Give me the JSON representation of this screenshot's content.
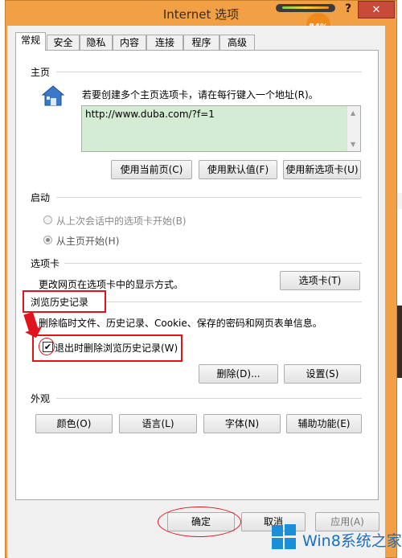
{
  "window": {
    "title": "Internet 选项",
    "help": "?",
    "close": "✕",
    "badge_text": "84%",
    "accent": "#f2a046"
  },
  "tabs": [
    "常规",
    "安全",
    "隐私",
    "内容",
    "连接",
    "程序",
    "高级"
  ],
  "home": {
    "section": "主页",
    "instruction": "若要创建多个主页选项卡，请在每行键入一个地址(R)。",
    "url": "http://www.duba.com/?f=1",
    "btn_current": "使用当前页(C)",
    "btn_default": "使用默认值(F)",
    "btn_newtab": "使用新选项卡(U)"
  },
  "startup": {
    "section": "启动",
    "opt_last": "从上次会话中的选项卡开始(B)",
    "opt_home": "从主页开始(H)"
  },
  "tabs_section": {
    "section": "选项卡",
    "desc": "更改网页在选项卡中的显示方式。",
    "btn": "选项卡(T)"
  },
  "history": {
    "section": "浏览历史记录",
    "desc": "删除临时文件、历史记录、Cookie、保存的密码和网页表单信息。",
    "checkbox_label": "退出时删除浏览历史记录(W)",
    "checked": true,
    "btn_delete": "删除(D)...",
    "btn_settings": "设置(S)"
  },
  "appearance": {
    "section": "外观",
    "btn_colors": "颜色(O)",
    "btn_lang": "语言(L)",
    "btn_fonts": "字体(N)",
    "btn_access": "辅助功能(E)"
  },
  "footer": {
    "ok": "确定",
    "cancel": "取消",
    "apply": "应用(A)"
  },
  "watermark": "Win8系统之家",
  "annotation_color": "#e0141e"
}
